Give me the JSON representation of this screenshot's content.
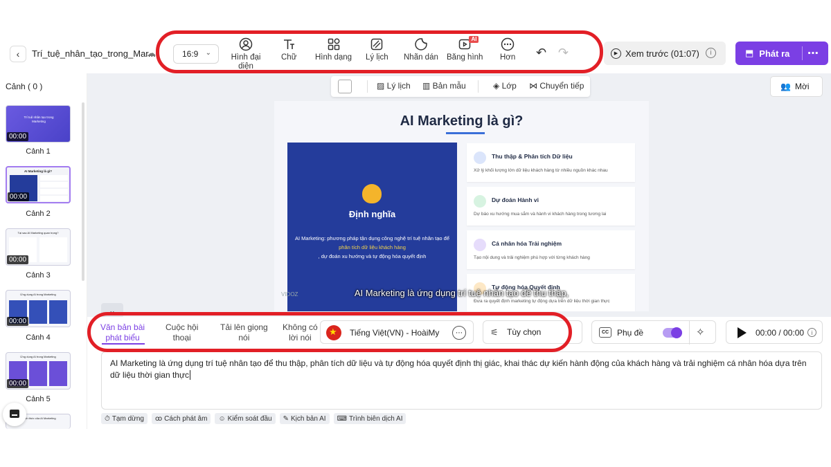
{
  "header": {
    "project_title": "Trí_tuệ_nhân_tạo_trong_Mar...",
    "aspect_ratio": "16:9",
    "tools": [
      {
        "label": "Hình đại diện",
        "icon": "avatar-icon"
      },
      {
        "label": "Chữ",
        "icon": "text-icon"
      },
      {
        "label": "Hình dạng",
        "icon": "shapes-icon"
      },
      {
        "label": "Lý lịch",
        "icon": "background-icon"
      },
      {
        "label": "Nhãn dán",
        "icon": "sticker-icon"
      },
      {
        "label": "Băng hình",
        "icon": "video-icon",
        "badge": "AI"
      },
      {
        "label": "Hơn",
        "icon": "more-icon"
      }
    ],
    "preview_label": "Xem trước (01:07)",
    "publish_label": "Phát ra"
  },
  "scenes": {
    "title": "Cảnh ( 0 )",
    "items": [
      {
        "label": "Cảnh 1",
        "time": "00:00",
        "thumb_title": "Trí tuệ nhân tạo trong Marketing"
      },
      {
        "label": "Cảnh 2",
        "time": "00:00",
        "thumb_title": "AI Marketing là gì?"
      },
      {
        "label": "Cảnh 3",
        "time": "00:00",
        "thumb_title": "Tại sao AI Marketing quan trọng?"
      },
      {
        "label": "Cảnh 4",
        "time": "00:00",
        "thumb_title": "Ứng dụng AI trong Marketing"
      },
      {
        "label": "Cảnh 5",
        "time": "00:00",
        "thumb_title": "Ứng dụng AI trong Marketing"
      },
      {
        "label": "",
        "time": "",
        "thumb_title": "Thách thức của AI Marketing"
      }
    ]
  },
  "canvas_toolbar": {
    "background": "Lý lịch",
    "template": "Bản mẫu",
    "layer": "Lớp",
    "transition": "Chuyển tiếp"
  },
  "invite_label": "Mời",
  "slide": {
    "title": "AI Marketing là gì?",
    "definition_title": "Định nghĩa",
    "definition_line1": "AI Marketing: phương pháp tận dụng công nghệ trí tuệ nhân tạo để",
    "definition_line2": "phân tích dữ liệu khách hàng",
    "definition_line3": ", dự đoán xu hướng và tự động hóa quyết định",
    "features": [
      {
        "title": "Thu thập & Phân tích Dữ liệu",
        "desc": "Xử lý khối lượng lớn dữ liệu khách hàng từ nhiều nguồn khác nhau",
        "color": "#3a6fd8"
      },
      {
        "title": "Dự đoán Hành vi",
        "desc": "Dự báo xu hướng mua sắm và hành vi khách hàng trong tương lai",
        "color": "#57c785"
      },
      {
        "title": "Cá nhân hóa Trải nghiệm",
        "desc": "Tạo nội dung và trải nghiệm phù hợp với từng khách hàng",
        "color": "#8b5cf6"
      },
      {
        "title": "Tự động hóa Quyết định",
        "desc": "Đưa ra quyết định marketing tự động dựa trên dữ liệu thời gian thực",
        "color": "#f59e0b"
      }
    ],
    "subtitle": "AI Marketing là ứng dụng trí tuệ nhân tạo để thu thập,",
    "watermark": "VIDOZ"
  },
  "bottom": {
    "tabs": [
      {
        "label1": "Văn bản bài",
        "label2": "phát biểu"
      },
      {
        "label1": "Cuộc hội",
        "label2": "thoại"
      },
      {
        "label1": "Tải lên giọng",
        "label2": "nói"
      },
      {
        "label1": "Không có",
        "label2": "lời nói"
      }
    ],
    "voice": "Tiếng Việt(VN) - HoàiMy",
    "options": "Tùy chọn",
    "subtitle_label": "Phụ đề",
    "player_time": "00:00 / 00:00",
    "script_text": "AI Marketing là ứng dụng trí tuệ nhân tạo để thu thập, phân tích dữ liệu và tự động hóa quyết định thị giác, khai thác dự kiến hành động của khách hàng và trải nghiệm cá nhân hóa dựa trên dữ liệu thời gian thực",
    "chips": [
      {
        "label": "Tạm dừng",
        "icon": "⏱"
      },
      {
        "label": "Cách phát âm",
        "icon": "ꝏ"
      },
      {
        "label": "Kiểm soát đầu",
        "icon": "☺"
      },
      {
        "label": "Kịch bản AI",
        "icon": "✎"
      },
      {
        "label": "Trình biên dịch AI",
        "icon": "⌨"
      }
    ]
  }
}
